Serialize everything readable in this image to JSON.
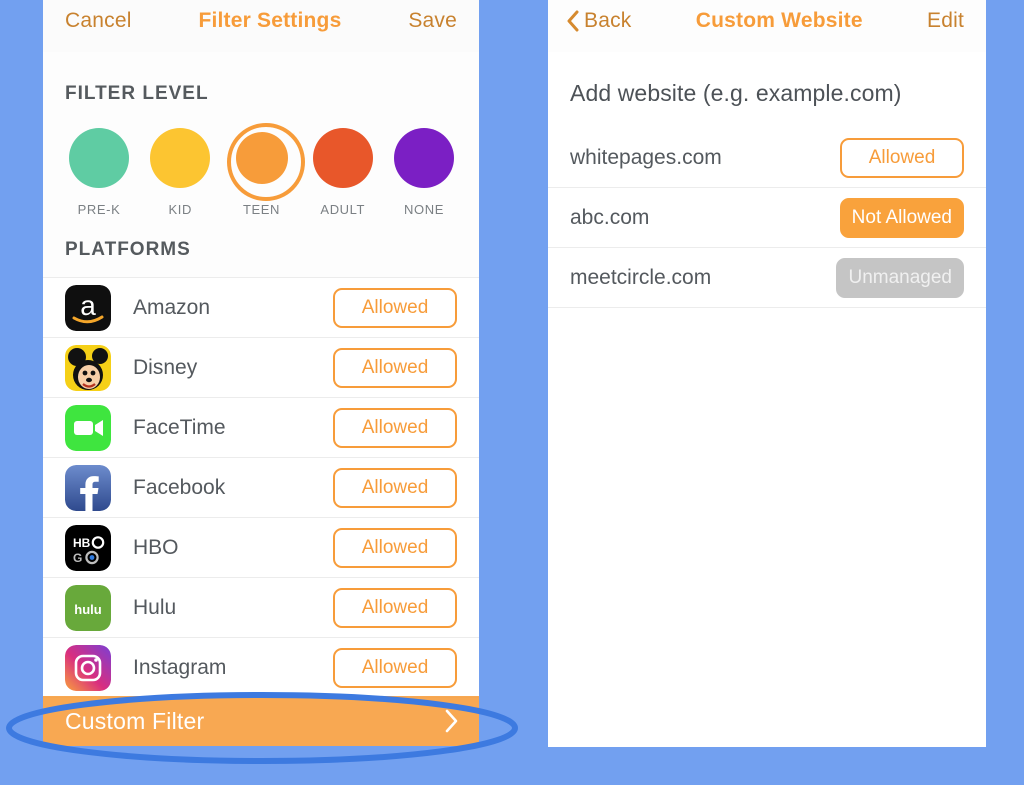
{
  "theme": {
    "background": "#72a0f0",
    "accent_orange": "#f79c3a",
    "nav_link": "#c8822f",
    "text_dark": "#54595e",
    "annotation_blue": "#3d7ae0"
  },
  "left_screen": {
    "nav": {
      "cancel_label": "Cancel",
      "title": "Filter Settings",
      "save_label": "Save"
    },
    "filter_level": {
      "section_title": "FILTER LEVEL",
      "levels": [
        {
          "label": "PRE-K",
          "color": "#5fcca3",
          "selected": false
        },
        {
          "label": "KID",
          "color": "#fcc531",
          "selected": false
        },
        {
          "label": "TEEN",
          "color": "#f79c3a",
          "selected": true
        },
        {
          "label": "ADULT",
          "color": "#e8572a",
          "selected": false
        },
        {
          "label": "NONE",
          "color": "#7b1fc4",
          "selected": false
        }
      ]
    },
    "platforms": {
      "section_title": "PLATFORMS",
      "rows": [
        {
          "name": "Amazon",
          "icon": "amazon-icon",
          "status": "Allowed",
          "status_kind": "allowed"
        },
        {
          "name": "Disney",
          "icon": "disney-icon",
          "status": "Allowed",
          "status_kind": "allowed"
        },
        {
          "name": "FaceTime",
          "icon": "facetime-icon",
          "status": "Allowed",
          "status_kind": "allowed"
        },
        {
          "name": "Facebook",
          "icon": "facebook-icon",
          "status": "Allowed",
          "status_kind": "allowed"
        },
        {
          "name": "HBO",
          "icon": "hbo-go-icon",
          "status": "Allowed",
          "status_kind": "allowed"
        },
        {
          "name": "Hulu",
          "icon": "hulu-icon",
          "status": "Allowed",
          "status_kind": "allowed"
        },
        {
          "name": "Instagram",
          "icon": "instagram-icon",
          "status": "Allowed",
          "status_kind": "allowed"
        }
      ]
    },
    "custom_filter_bar": {
      "label": "Custom Filter",
      "chevron": "chevron-right-icon"
    }
  },
  "right_screen": {
    "nav": {
      "back_label": "Back",
      "back_icon": "chevron-left-icon",
      "title": "Custom Website",
      "edit_label": "Edit"
    },
    "add_website_label": "Add website (e.g. example.com)",
    "websites": [
      {
        "name": "whitepages.com",
        "status": "Allowed",
        "status_kind": "allowed"
      },
      {
        "name": "abc.com",
        "status": "Not Allowed",
        "status_kind": "not-allowed"
      },
      {
        "name": "meetcircle.com",
        "status": "Unmanaged",
        "status_kind": "unmanaged"
      }
    ]
  },
  "annotation": {
    "shape": "ellipse-highlight",
    "target": "Custom Filter"
  }
}
